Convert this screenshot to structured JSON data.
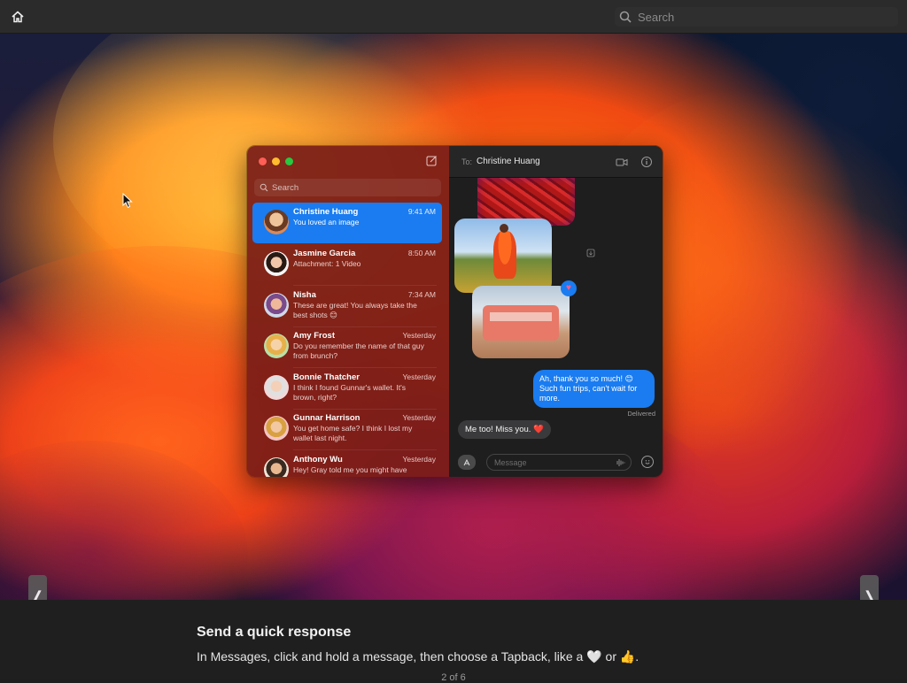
{
  "topbar": {
    "home_icon": "house-icon",
    "search_placeholder": "Search"
  },
  "window": {
    "sidebar": {
      "search_placeholder": "Search",
      "conversations": [
        {
          "name": "Christine Huang",
          "time": "9:41 AM",
          "preview": "You loved an image",
          "selected": true
        },
        {
          "name": "Jasmine Garcia",
          "time": "8:50 AM",
          "preview": "Attachment: 1 Video",
          "selected": false
        },
        {
          "name": "Nisha",
          "time": "7:34 AM",
          "preview": "These are great! You always take the best shots 😊",
          "selected": false
        },
        {
          "name": "Amy Frost",
          "time": "Yesterday",
          "preview": "Do you remember the name of that guy from brunch?",
          "selected": false
        },
        {
          "name": "Bonnie Thatcher",
          "time": "Yesterday",
          "preview": "I think I found Gunnar's wallet. It's brown, right?",
          "selected": false
        },
        {
          "name": "Gunnar Harrison",
          "time": "Yesterday",
          "preview": "You get home safe? I think I lost my wallet last night.",
          "selected": false
        },
        {
          "name": "Anthony Wu",
          "time": "Yesterday",
          "preview": "Hey! Gray told me you might have",
          "selected": false
        }
      ]
    },
    "chat": {
      "to_label": "To:",
      "to_name": "Christine Huang",
      "outgoing_message": "Ah, thank you so much! 😊 Such fun trips, can't wait for more.",
      "delivered": "Delivered",
      "incoming_message": "Me too! Miss you. ❤️",
      "message_placeholder": "Message"
    }
  },
  "caption": {
    "title": "Send a quick response",
    "description": "In Messages, click and hold a message, then choose a Tapback, like a 🤍 or 👍.",
    "pager": "2 of 6"
  },
  "nav": {
    "prev": "❬",
    "next": "❭"
  },
  "colors": {
    "selection_blue": "#1a7cf0",
    "sidebar_red": "#78201a",
    "close": "#ff5f57",
    "minimize": "#febc2e",
    "zoom": "#28c840"
  }
}
